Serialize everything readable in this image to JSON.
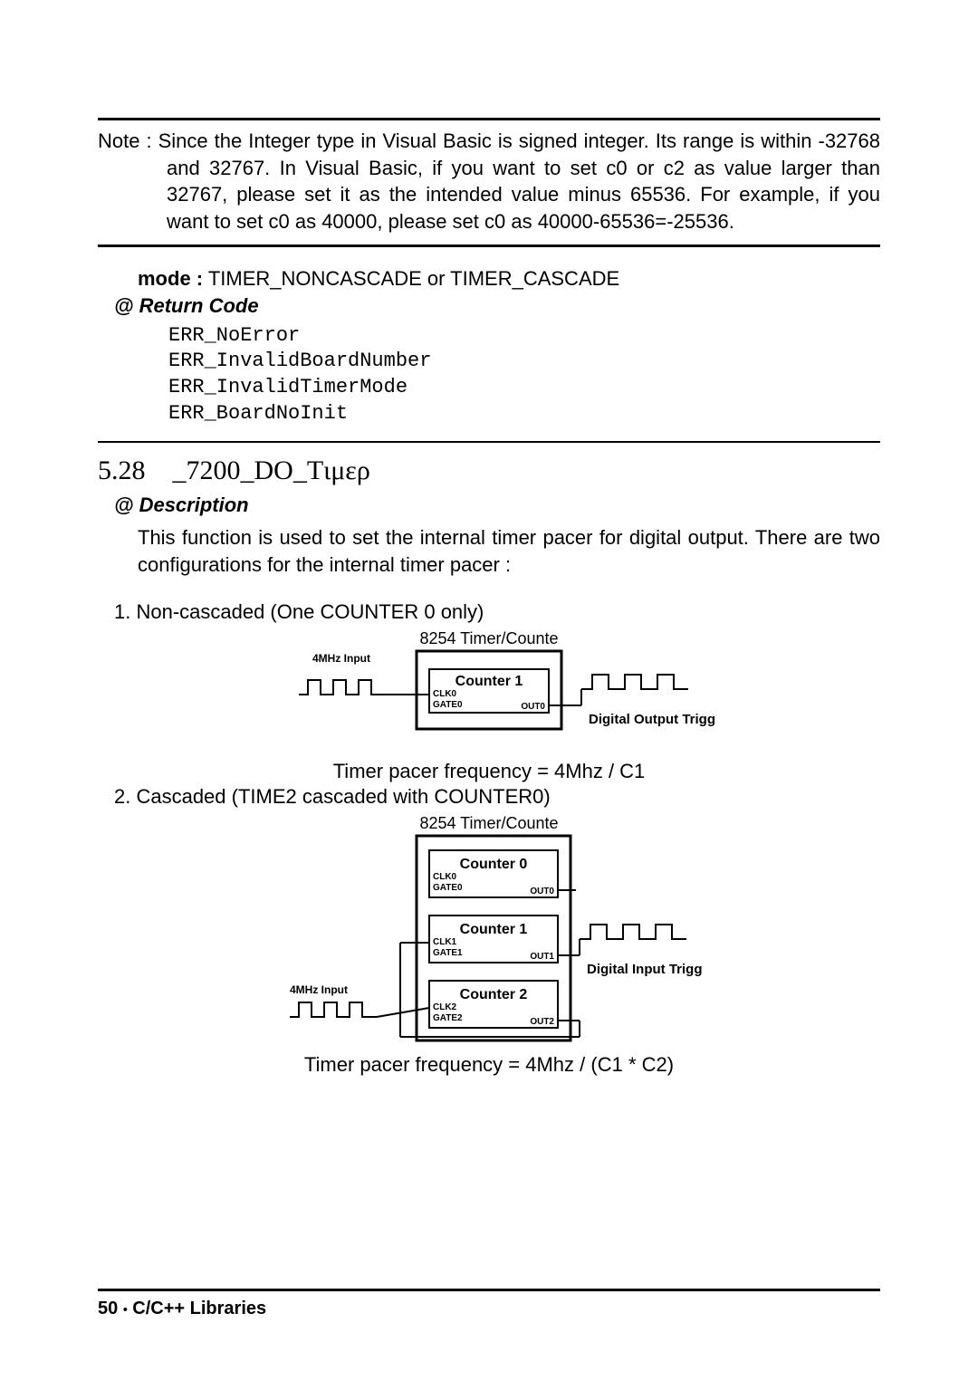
{
  "note": {
    "text": "Note : Since the Integer type in Visual Basic is signed integer. Its range is within -32768 and 32767. In Visual Basic, if you want to set c0 or c2 as value larger than 32767, please set it as the intended value minus 65536. For example, if you want to set c0 as 40000, please set c0 as 40000-65536=-25536."
  },
  "mode": {
    "label": "mode :",
    "value": "TIMER_NONCASCADE or TIMER_CASCADE"
  },
  "return_code": {
    "heading": "@ Return Code",
    "codes": "ERR_NoError\nERR_InvalidBoardNumber\nERR_InvalidTimerMode\nERR_BoardNoInit"
  },
  "section": {
    "number": "5.28",
    "title": "_7200_DO_Tιμερ"
  },
  "description": {
    "heading": "@ Description",
    "text": "This function is used to set the internal timer pacer for digital output. There are two configurations for the internal timer pacer :"
  },
  "item1": {
    "label": "1. Non-cascaded (One COUNTER 0 only)",
    "diagram": {
      "title": "8254 Timer/Counte",
      "input_label": "4MHz Input",
      "counter": "Counter 1",
      "clk": "CLK0",
      "gate": "GATE0",
      "out": "OUT0",
      "output_label": "Digital Output Trigg"
    },
    "caption": "Timer pacer frequency = 4Mhz / C1"
  },
  "item2": {
    "label": "2. Cascaded (TIME2 cascaded with COUNTER0)",
    "diagram": {
      "title": "8254 Timer/Counte",
      "input_label": "4MHz Input",
      "c0": {
        "name": "Counter 0",
        "clk": "CLK0",
        "gate": "GATE0",
        "out": "OUT0"
      },
      "c1": {
        "name": "Counter 1",
        "clk": "CLK1",
        "gate": "GATE1",
        "out": "OUT1"
      },
      "c2": {
        "name": "Counter 2",
        "clk": "CLK2",
        "gate": "GATE2",
        "out": "OUT2"
      },
      "output_label": "Digital Input Trigg"
    },
    "caption": "Timer pacer frequency = 4Mhz / (C1 * C2)"
  },
  "footer": {
    "page": "50",
    "dot": "•",
    "label": "C/C++ Libraries"
  }
}
